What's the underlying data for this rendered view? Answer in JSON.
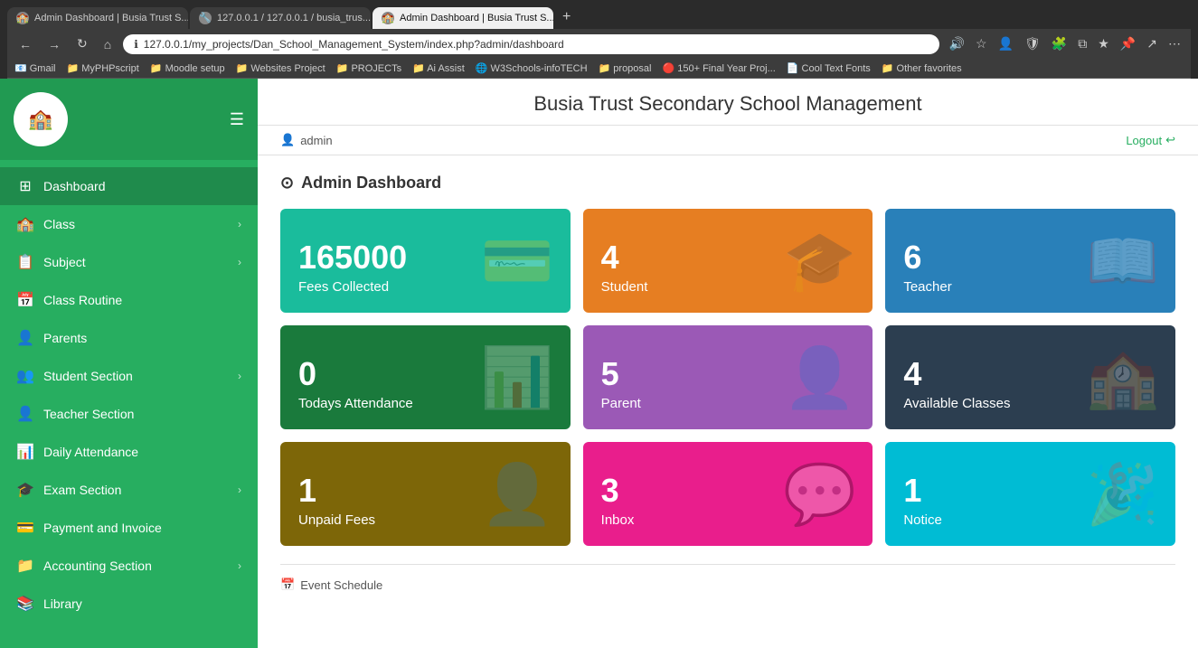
{
  "browser": {
    "tabs": [
      {
        "label": "Admin Dashboard | Busia Trust S...",
        "active": false,
        "favicon": "🏫"
      },
      {
        "label": "127.0.0.1 / 127.0.0.1 / busia_trus...",
        "active": false,
        "favicon": "🔧"
      },
      {
        "label": "Admin Dashboard | Busia Trust S...",
        "active": true,
        "favicon": "🏫"
      }
    ],
    "url": "127.0.0.1/my_projects/Dan_School_Management_System/index.php?admin/dashboard",
    "bookmarks": [
      "Gmail",
      "MyPHPscript",
      "Moodle setup",
      "Websites Project",
      "PROJECTs",
      "Ai Assist",
      "W3Schools-infoTECH",
      "proposal",
      "150+ Final Year Proj...",
      "Cool Text Fonts",
      "Other favorites"
    ]
  },
  "app": {
    "title": "Busia Trust Secondary School Management",
    "user": "admin",
    "logout_label": "Logout"
  },
  "sidebar": {
    "logo": "🏫",
    "items": [
      {
        "id": "dashboard",
        "label": "Dashboard",
        "icon": "⊞",
        "has_chevron": false,
        "active": true
      },
      {
        "id": "class",
        "label": "Class",
        "icon": "🏫",
        "has_chevron": true
      },
      {
        "id": "subject",
        "label": "Subject",
        "icon": "📋",
        "has_chevron": true
      },
      {
        "id": "class-routine",
        "label": "Class Routine",
        "icon": "📅",
        "has_chevron": false
      },
      {
        "id": "parents",
        "label": "Parents",
        "icon": "👤",
        "has_chevron": false
      },
      {
        "id": "student-section",
        "label": "Student Section",
        "icon": "👥",
        "has_chevron": true
      },
      {
        "id": "teacher-section",
        "label": "Teacher Section",
        "icon": "👤",
        "has_chevron": false
      },
      {
        "id": "daily-attendance",
        "label": "Daily Attendance",
        "icon": "📊",
        "has_chevron": false
      },
      {
        "id": "exam-section",
        "label": "Exam Section",
        "icon": "🎓",
        "has_chevron": true
      },
      {
        "id": "payment-invoice",
        "label": "Payment and Invoice",
        "icon": "💳",
        "has_chevron": false
      },
      {
        "id": "accounting-section",
        "label": "Accounting Section",
        "icon": "📁",
        "has_chevron": true
      },
      {
        "id": "library",
        "label": "Library",
        "icon": "📚",
        "has_chevron": false
      }
    ]
  },
  "page": {
    "title": "Admin Dashboard",
    "cards": [
      {
        "id": "fees",
        "number": "165000",
        "label": "Fees Collected",
        "icon": "💳",
        "color_class": "card-teal"
      },
      {
        "id": "student",
        "number": "4",
        "label": "Student",
        "icon": "🎓",
        "color_class": "card-orange"
      },
      {
        "id": "teacher",
        "number": "6",
        "label": "Teacher",
        "icon": "📖",
        "color_class": "card-blue"
      },
      {
        "id": "attendance",
        "number": "0",
        "label": "Todays Attendance",
        "icon": "📊",
        "color_class": "card-green-dark"
      },
      {
        "id": "parent",
        "number": "5",
        "label": "Parent",
        "icon": "👤",
        "color_class": "card-purple"
      },
      {
        "id": "classes",
        "number": "4",
        "label": "Available Classes",
        "icon": "🏫",
        "color_class": "card-dark"
      },
      {
        "id": "unpaid",
        "number": "1",
        "label": "Unpaid Fees",
        "icon": "👤",
        "color_class": "card-olive"
      },
      {
        "id": "inbox",
        "number": "3",
        "label": "Inbox",
        "icon": "💬",
        "color_class": "card-pink"
      },
      {
        "id": "notice",
        "number": "1",
        "label": "Notice",
        "icon": "🎉",
        "color_class": "card-cyan"
      }
    ],
    "event_schedule_label": "Event Schedule"
  }
}
